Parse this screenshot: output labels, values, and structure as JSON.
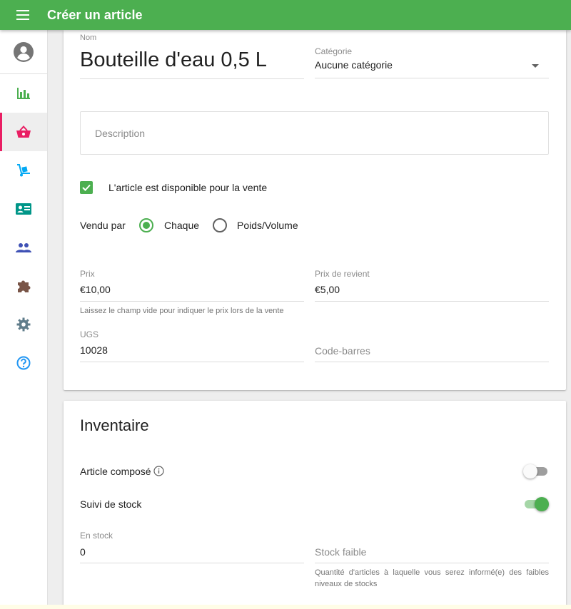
{
  "app_bar": {
    "title": "Créer un article",
    "menu_icon": "menu-icon"
  },
  "sidebar": {
    "avatar_icon": "account-circle-icon",
    "items": [
      {
        "icon": "bar-chart-icon",
        "color": "#4caf50"
      },
      {
        "icon": "basket-icon",
        "color": "#e91e63",
        "active": true
      },
      {
        "icon": "hand-truck-icon",
        "color": "#03a9f4"
      },
      {
        "icon": "id-card-icon",
        "color": "#009688"
      },
      {
        "icon": "people-icon",
        "color": "#3f51b5"
      },
      {
        "icon": "puzzle-icon",
        "color": "#795548"
      },
      {
        "icon": "gear-icon",
        "color": "#607d8b"
      },
      {
        "icon": "help-circle-icon",
        "color": "#2196f3"
      }
    ]
  },
  "item_form": {
    "name_label": "Nom",
    "name_value": "Bouteille d'eau 0,5 L",
    "category_label": "Catégorie",
    "category_value": "Aucune catégorie",
    "description_placeholder": "Description",
    "available_label": "L'article est disponible pour la vente",
    "available_checked": true,
    "sold_by_label": "Vendu par",
    "sold_by_options": [
      "Chaque",
      "Poids/Volume"
    ],
    "sold_by_selected": "Chaque",
    "price_label": "Prix",
    "price_value": "€10,00",
    "price_hint": "Laissez le champ vide pour indiquer le prix lors de la vente",
    "cost_label": "Prix de revient",
    "cost_value": "€5,00",
    "sku_label": "UGS",
    "sku_value": "10028",
    "barcode_placeholder": "Code-barres"
  },
  "inventory": {
    "title": "Inventaire",
    "composite_label": "Article composé",
    "composite_on": false,
    "track_stock_label": "Suivi de stock",
    "track_stock_on": true,
    "in_stock_label": "En stock",
    "in_stock_value": "0",
    "low_stock_placeholder": "Stock faible",
    "low_stock_hint": "Quantité d'articles à laquelle vous serez informé(e) des faibles niveaux de stocks"
  },
  "colors": {
    "primary": "#4caf50",
    "accent": "#e91e63"
  }
}
